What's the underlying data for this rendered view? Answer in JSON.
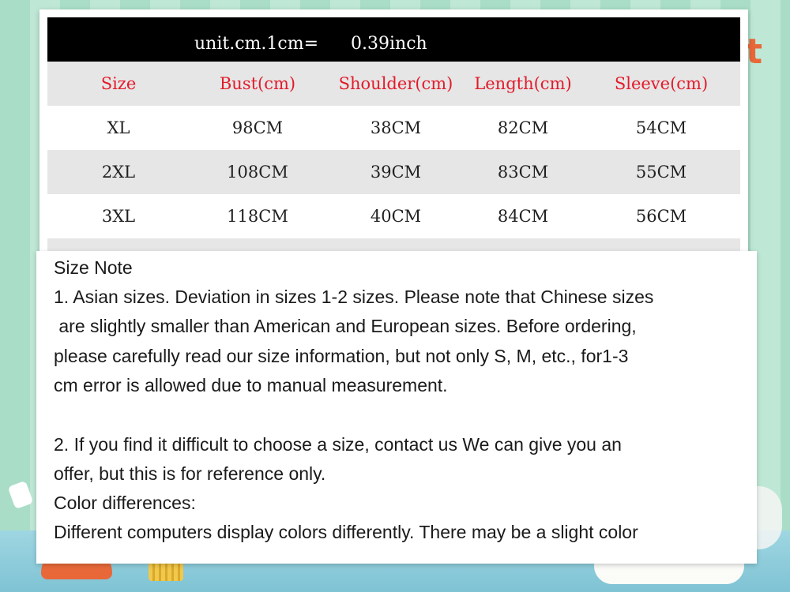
{
  "decor": {
    "corner_letter": "t"
  },
  "unit_bar": {
    "left": "unit.cm.1cm=",
    "right": "0.39inch"
  },
  "table": {
    "headers": [
      "Size",
      "Bust(cm)",
      "Shoulder(cm)",
      "Length(cm)",
      "Sleeve(cm)"
    ],
    "rows": [
      [
        "XL",
        "98CM",
        "38CM",
        "82CM",
        "54CM"
      ],
      [
        "2XL",
        "108CM",
        "39CM",
        "83CM",
        "55CM"
      ],
      [
        "3XL",
        "118CM",
        "40CM",
        "84CM",
        "56CM"
      ]
    ]
  },
  "note": {
    "title": "Size Note",
    "lines": [
      "1. Asian sizes. Deviation in sizes 1-2 sizes. Please note that Chinese sizes",
      " are slightly smaller than American and European sizes. Before ordering,",
      "please carefully read our size information, but not only S, M, etc., for1-3",
      "cm error is allowed due to manual measurement.",
      "2. If you find it difficult to choose a size, contact us We can give you an",
      "offer, but this is for reference only.",
      "Color differences:",
      "Different computers display colors differently. There may be a slight color"
    ]
  },
  "colors": {
    "header_text": "#e31b2b",
    "unit_bar_bg": "#000000",
    "background": "#a8dcc6"
  }
}
